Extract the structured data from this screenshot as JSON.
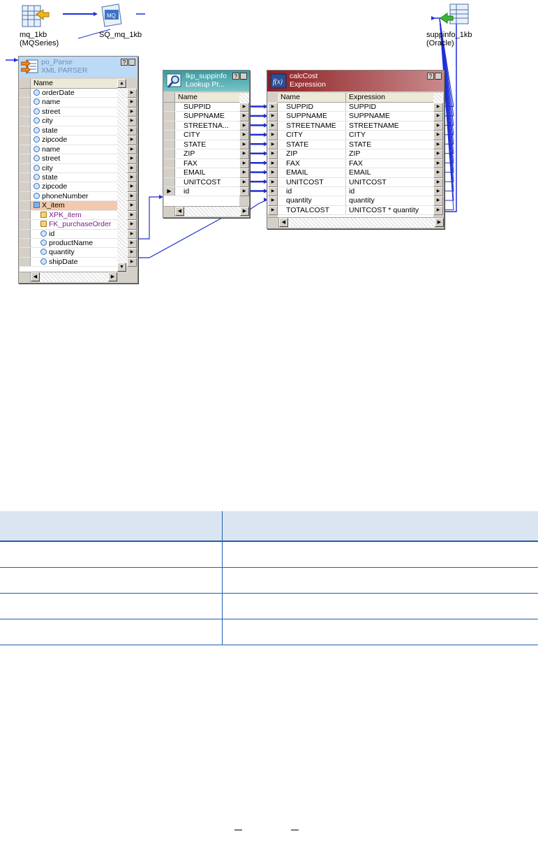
{
  "canvas": {
    "source_icons": [
      {
        "name": "mq-table-icon",
        "label": "mq_1kb (MQSeries)"
      },
      {
        "name": "mq-source-qualifier-icon",
        "label": "SQ_mq_1kb"
      },
      {
        "name": "oracle-target-icon",
        "label": "suppinfo_1kb (Oracle)"
      }
    ]
  },
  "po_parse": {
    "title": "po_Parse",
    "subtitle": "XML PARSER",
    "column_header": "Name",
    "help_label": "?",
    "minimize_label": "_",
    "ports": [
      "orderDate",
      "name",
      "street",
      "city",
      "state",
      "zipcode",
      "name",
      "street",
      "city",
      "state",
      "zipcode",
      "phoneNumber",
      "X_item",
      "XPK_item",
      "FK_purchaseOrder",
      "id",
      "productName",
      "quantity",
      "shipDate"
    ]
  },
  "lkp": {
    "title": "lkp_suppinfo",
    "subtitle": "Lookup Pr...",
    "column_header": "Name",
    "help_label": "?",
    "minimize_label": "_",
    "ports": [
      "SUPPID",
      "SUPPNAME",
      "STREETNA...",
      "CITY",
      "STATE",
      "ZIP",
      "FAX",
      "EMAIL",
      "UNITCOST",
      "id"
    ]
  },
  "calc": {
    "title": "calcCost",
    "subtitle": "Expression",
    "name_header": "Name",
    "expr_header": "Expression",
    "help_label": "?",
    "minimize_label": "_",
    "ports": [
      {
        "name": "SUPPID",
        "expr": "SUPPID"
      },
      {
        "name": "SUPPNAME",
        "expr": "SUPPNAME"
      },
      {
        "name": "STREETNAME",
        "expr": "STREETNAME"
      },
      {
        "name": "CITY",
        "expr": "CITY"
      },
      {
        "name": "STATE",
        "expr": "STATE"
      },
      {
        "name": "ZIP",
        "expr": "ZIP"
      },
      {
        "name": "FAX",
        "expr": "FAX"
      },
      {
        "name": "EMAIL",
        "expr": "EMAIL"
      },
      {
        "name": "UNITCOST",
        "expr": "UNITCOST"
      },
      {
        "name": "id",
        "expr": "id"
      },
      {
        "name": "quantity",
        "expr": "quantity"
      },
      {
        "name": "TOTALCOST",
        "expr": "UNITCOST * quantity"
      }
    ]
  },
  "colors": {
    "link": "#1f2fd6",
    "po_header": "#bcd9f5",
    "lkp_header": "#3a9aa0",
    "calc_header": "#8e1f22",
    "table_rule": "#1f5fae",
    "table_header_bg": "#dbe5f1"
  }
}
